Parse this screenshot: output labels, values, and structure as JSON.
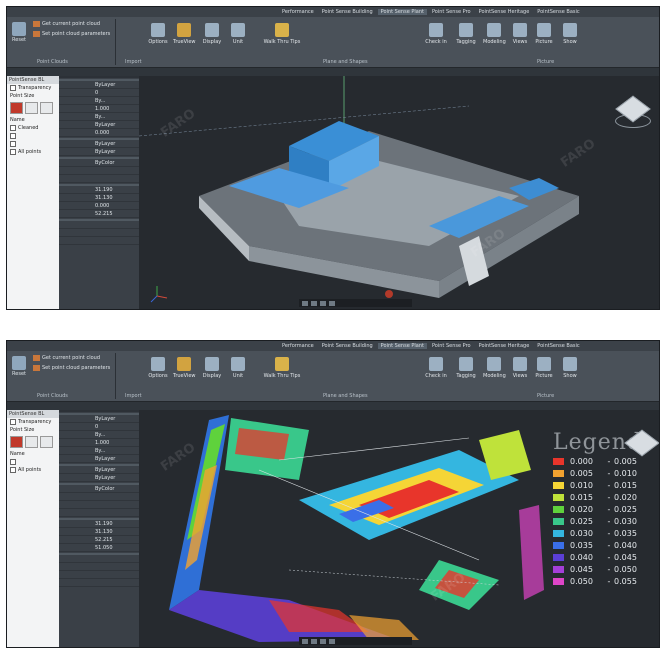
{
  "menu": [
    "",
    "",
    "",
    "",
    "",
    "",
    "",
    "",
    "",
    "",
    "",
    "",
    "",
    "",
    "",
    "Performance",
    "Point Sense Building",
    "Point Sense Plant",
    "Point Sense Pro",
    "PointSense Heritage",
    "PointSense Basic"
  ],
  "menu_active_index": 17,
  "ribbon": {
    "app_label": "Reset",
    "cmd_get_point": "Get current point cloud",
    "cmd_params": "Set point cloud parameters",
    "big_buttons": [
      "Options",
      "TrueView",
      "Display",
      "Unit",
      "Walk Thru Tips",
      "Check in",
      "Tagging",
      "Modeling",
      "Views",
      "Picture",
      "Show"
    ],
    "groups": [
      "Point Clouds",
      "Import",
      "Plane and Shapes",
      "Picture"
    ]
  },
  "left_panel": {
    "header": "PointSense BL",
    "transparency": "Transparency",
    "point_size": "Point Size",
    "section_name": "Name",
    "items_top": [
      "Cleaned",
      "",
      "",
      "All points"
    ],
    "items_bottom": [
      "",
      "All points"
    ]
  },
  "props": {
    "title": "",
    "sections": [
      "",
      "",
      "",
      "",
      ""
    ],
    "rows_general": [
      {
        "k": "",
        "v": "ByLayer"
      },
      {
        "k": "",
        "v": "0"
      },
      {
        "k": "",
        "v": "By..."
      },
      {
        "k": "",
        "v": "1.000"
      },
      {
        "k": "",
        "v": "By..."
      },
      {
        "k": "",
        "v": "ByLayer"
      },
      {
        "k": "",
        "v": "0.000"
      }
    ],
    "rows_3d": [
      {
        "k": "",
        "v": "ByLayer"
      },
      {
        "k": "",
        "v": "ByLayer"
      }
    ],
    "rows_print": [
      {
        "k": "",
        "v": "ByColor"
      },
      {
        "k": "",
        "v": ""
      },
      {
        "k": "",
        "v": ""
      },
      {
        "k": "",
        "v": ""
      }
    ],
    "rows_view": [
      {
        "k": "",
        "v": "31.190"
      },
      {
        "k": "",
        "v": "31.130"
      },
      {
        "k": "",
        "v": "0.000"
      },
      {
        "k": "",
        "v": "52.215"
      },
      {
        "k": "",
        "v": "51.050"
      }
    ],
    "rows_misc": [
      {
        "k": "",
        "v": ""
      },
      {
        "k": "",
        "v": ""
      },
      {
        "k": "",
        "v": ""
      },
      {
        "k": "",
        "v": ""
      },
      {
        "k": "",
        "v": ""
      }
    ]
  },
  "legend": {
    "title": "Legend",
    "rows": [
      {
        "color": "#e8352b",
        "lo": "0.000",
        "hi": "0.005"
      },
      {
        "color": "#f2a230",
        "lo": "0.005",
        "hi": "0.010"
      },
      {
        "color": "#f5d536",
        "lo": "0.010",
        "hi": "0.015"
      },
      {
        "color": "#bfe23a",
        "lo": "0.015",
        "hi": "0.020"
      },
      {
        "color": "#5fd23c",
        "lo": "0.020",
        "hi": "0.025"
      },
      {
        "color": "#39c78a",
        "lo": "0.025",
        "hi": "0.030"
      },
      {
        "color": "#34b6e0",
        "lo": "0.030",
        "hi": "0.035"
      },
      {
        "color": "#3a6fe8",
        "lo": "0.035",
        "hi": "0.040"
      },
      {
        "color": "#5b3fd6",
        "lo": "0.040",
        "hi": "0.045"
      },
      {
        "color": "#a43fd8",
        "lo": "0.045",
        "hi": "0.050"
      },
      {
        "color": "#de45c8",
        "lo": "0.050",
        "hi": "0.055"
      }
    ]
  },
  "watermark": "FARO"
}
